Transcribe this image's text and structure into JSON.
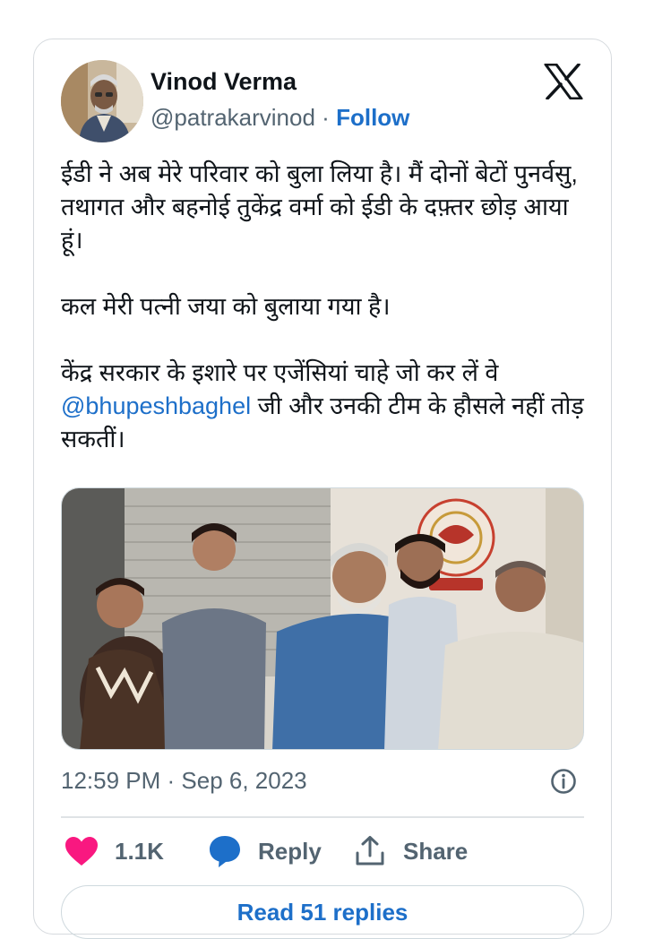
{
  "tweet": {
    "author": {
      "display_name": "Vinod Verma",
      "handle": "@patrakarvinod",
      "separator": "·",
      "follow_label": "Follow"
    },
    "logo_icon": "x-logo-icon",
    "body": {
      "paragraph1": "ईडी ने अब मेरे परिवार को बुला लिया है। मैं दोनों बेटों पुनर्वसु, तथागत और बहनोई तुकेंद्र वर्मा को ईडी के दफ़्तर छोड़ आया हूं।",
      "paragraph2": "कल मेरी पत्नी जया को बुलाया गया है।",
      "paragraph3_start": "केंद्र सरकार के इशारे पर एजेंसियां चाहे जो कर लें वे ",
      "mention": "@bhupeshbaghel",
      "paragraph3_end": " जी और उनकी टीम के हौसले नहीं तोड़ सकतीं।"
    },
    "meta": {
      "time": "12:59 PM",
      "separator": " · ",
      "date": "Sep 6, 2023"
    },
    "actions": {
      "like_count": "1.1K",
      "reply_label": "Reply",
      "share_label": "Share"
    },
    "read_replies_label": "Read 51 replies",
    "colors": {
      "accent": "#1d6fc9",
      "like": "#f91880",
      "muted": "#536471"
    }
  }
}
